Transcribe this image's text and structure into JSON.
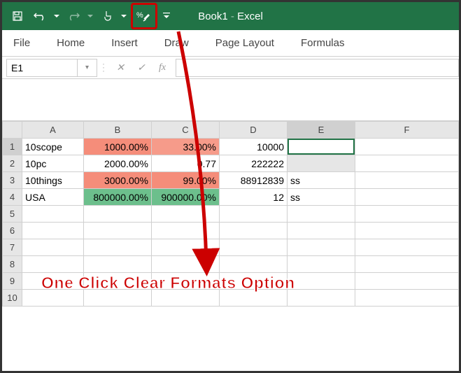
{
  "title": {
    "doc": "Book1",
    "app": "Excel"
  },
  "ribbon": {
    "file": "File",
    "home": "Home",
    "insert": "Insert",
    "draw": "Draw",
    "page_layout": "Page Layout",
    "formulas": "Formulas"
  },
  "formula_bar": {
    "name_box": "E1",
    "fx": "fx"
  },
  "columns": [
    "A",
    "B",
    "C",
    "D",
    "E",
    "F"
  ],
  "rows": {
    "r1": {
      "n": "1",
      "a": "10scope",
      "b": "1000.00%",
      "c": "33.00%",
      "d": "10000",
      "e": "",
      "f": ""
    },
    "r2": {
      "n": "2",
      "a": "10pc",
      "b": "2000.00%",
      "c": "0.77",
      "d": "222222",
      "e": "",
      "f": ""
    },
    "r3": {
      "n": "3",
      "a": "10things",
      "b": "3000.00%",
      "c": "99.00%",
      "d": "88912839",
      "e": "ss",
      "f": ""
    },
    "r4": {
      "n": "4",
      "a": "USA",
      "b": "800000.00%",
      "c": "900000.00%",
      "d": "12",
      "e": "ss",
      "f": ""
    },
    "r5": {
      "n": "5"
    },
    "r6": {
      "n": "6"
    },
    "r7": {
      "n": "7"
    },
    "r8": {
      "n": "8"
    },
    "r9": {
      "n": "9"
    },
    "r10": {
      "n": "10"
    }
  },
  "cell_colors": {
    "b1": "#f58d7a",
    "c1": "#f69b8a",
    "b3": "#f58d7a",
    "c3": "#f58d7a",
    "b4": "#6cbf8c",
    "c4": "#6cbf8c"
  },
  "annotation": "One Click Clear Formats Option",
  "chart_data": {
    "type": "table",
    "columns": [
      "A",
      "B",
      "C",
      "D",
      "E"
    ],
    "rows": [
      [
        "10scope",
        "1000.00%",
        "33.00%",
        10000,
        ""
      ],
      [
        "10pc",
        "2000.00%",
        0.77,
        222222,
        ""
      ],
      [
        "10things",
        "3000.00%",
        "99.00%",
        88912839,
        "ss"
      ],
      [
        "USA",
        "800000.00%",
        "900000.00%",
        12,
        "ss"
      ]
    ]
  }
}
